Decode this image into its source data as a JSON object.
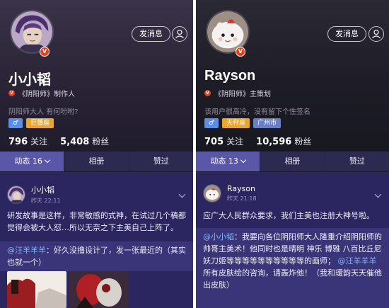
{
  "profiles": [
    {
      "name": "小小韬",
      "role": "《阴阳师》制作人",
      "bio": "阴阳师大人 有何吩咐?",
      "tags": [
        "♂",
        "巨蟹座"
      ],
      "following_count": "796",
      "following_label": "关注",
      "followers_count": "5,408",
      "followers_label": "粉丝",
      "message_button": "发消息",
      "tabs": [
        "动态 16",
        "相册",
        "赞过"
      ],
      "post": {
        "author": "小小韬",
        "time": "昨天 22:11",
        "text": "研发故事是这样，非常敏感的式神，在试过几个稿都觉得会被大人怼…所以无奈之下主美自己上阵了。",
        "quote_at": "@汪羊羊羊",
        "quote_text": "：好久没撸设计了，发一张最近的（其实也就一个）"
      }
    },
    {
      "name": "Rayson",
      "role": "《阴阳师》主策划",
      "bio": "该用户很高冷，没有留下个性签名",
      "tags": [
        "♂",
        "天秤座",
        "广州市"
      ],
      "following_count": "705",
      "following_label": "关注",
      "followers_count": "10,596",
      "followers_label": "粉丝",
      "message_button": "发消息",
      "tabs": [
        "动态 13",
        "相册",
        "赞过"
      ],
      "post": {
        "author": "Rayson",
        "time": "昨天 21:18",
        "text": "应广大人民群众要求，我们主美也注册大神号啦。",
        "quote_at": "@小小韬",
        "quote_text": "：我要向各位阴阳师大人隆重介绍阴阳师的帅哥主美术！他同时也是晴明 神乐 博雅 八百比丘尼 妖刀姬等等等等等等等等等等的画师；",
        "quote_at2": "@汪羊羊羊",
        "quote_text2": "所有皮肤绘的咨询，请轰炸他！（我和瑷韵天天催他出皮肤）"
      }
    }
  ],
  "colors": {
    "accent_tab": "#5a56a8",
    "feed_bg": "#2b2560",
    "mention": "#7fb6ff",
    "verified": "#e2431d"
  }
}
